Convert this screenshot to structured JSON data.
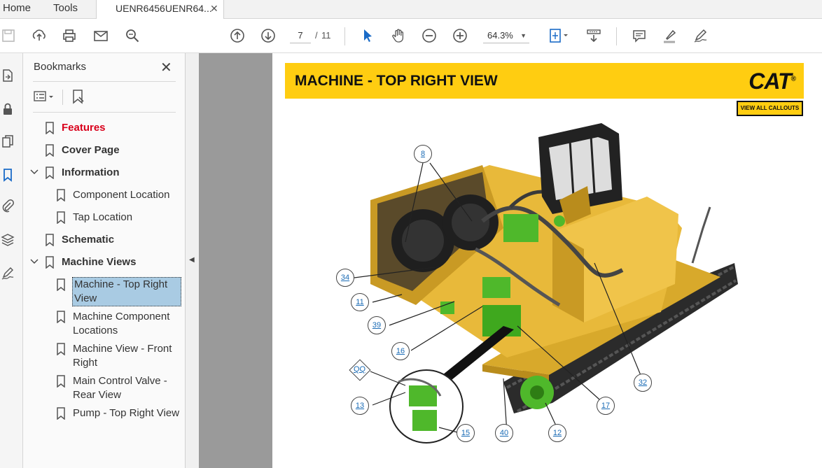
{
  "tabs": {
    "home": "Home",
    "tools": "Tools",
    "doc": "UENR6456UENR64...",
    "close": "✕"
  },
  "toolbar": {
    "page_current": "7",
    "page_sep": "/",
    "page_total": "11",
    "zoom": "64.3%"
  },
  "bookmarks": {
    "title": "Bookmarks",
    "items": [
      {
        "label": "Features"
      },
      {
        "label": "Cover Page"
      },
      {
        "label": "Information"
      },
      {
        "label": "Component Location"
      },
      {
        "label": "Tap Location"
      },
      {
        "label": "Schematic"
      },
      {
        "label": "Machine Views"
      },
      {
        "label": "Machine - Top Right View"
      },
      {
        "label": "Machine Component Locations"
      },
      {
        "label": "Machine View - Front Right"
      },
      {
        "label": "Main Control Valve - Rear View"
      },
      {
        "label": "Pump - Top Right View"
      }
    ]
  },
  "doc": {
    "title": "MACHINE - TOP RIGHT VIEW",
    "logo": "CAT",
    "view_all": "VIEW ALL CALLOUTS",
    "callouts": [
      "8",
      "34",
      "11",
      "39",
      "16",
      "QQ",
      "13",
      "15",
      "40",
      "12",
      "17",
      "32"
    ]
  },
  "colors": {
    "accent": "#ffcd11",
    "selection": "#a9cbe3",
    "link": "#1a6bb5",
    "red_bookmark": "#d9001b"
  }
}
